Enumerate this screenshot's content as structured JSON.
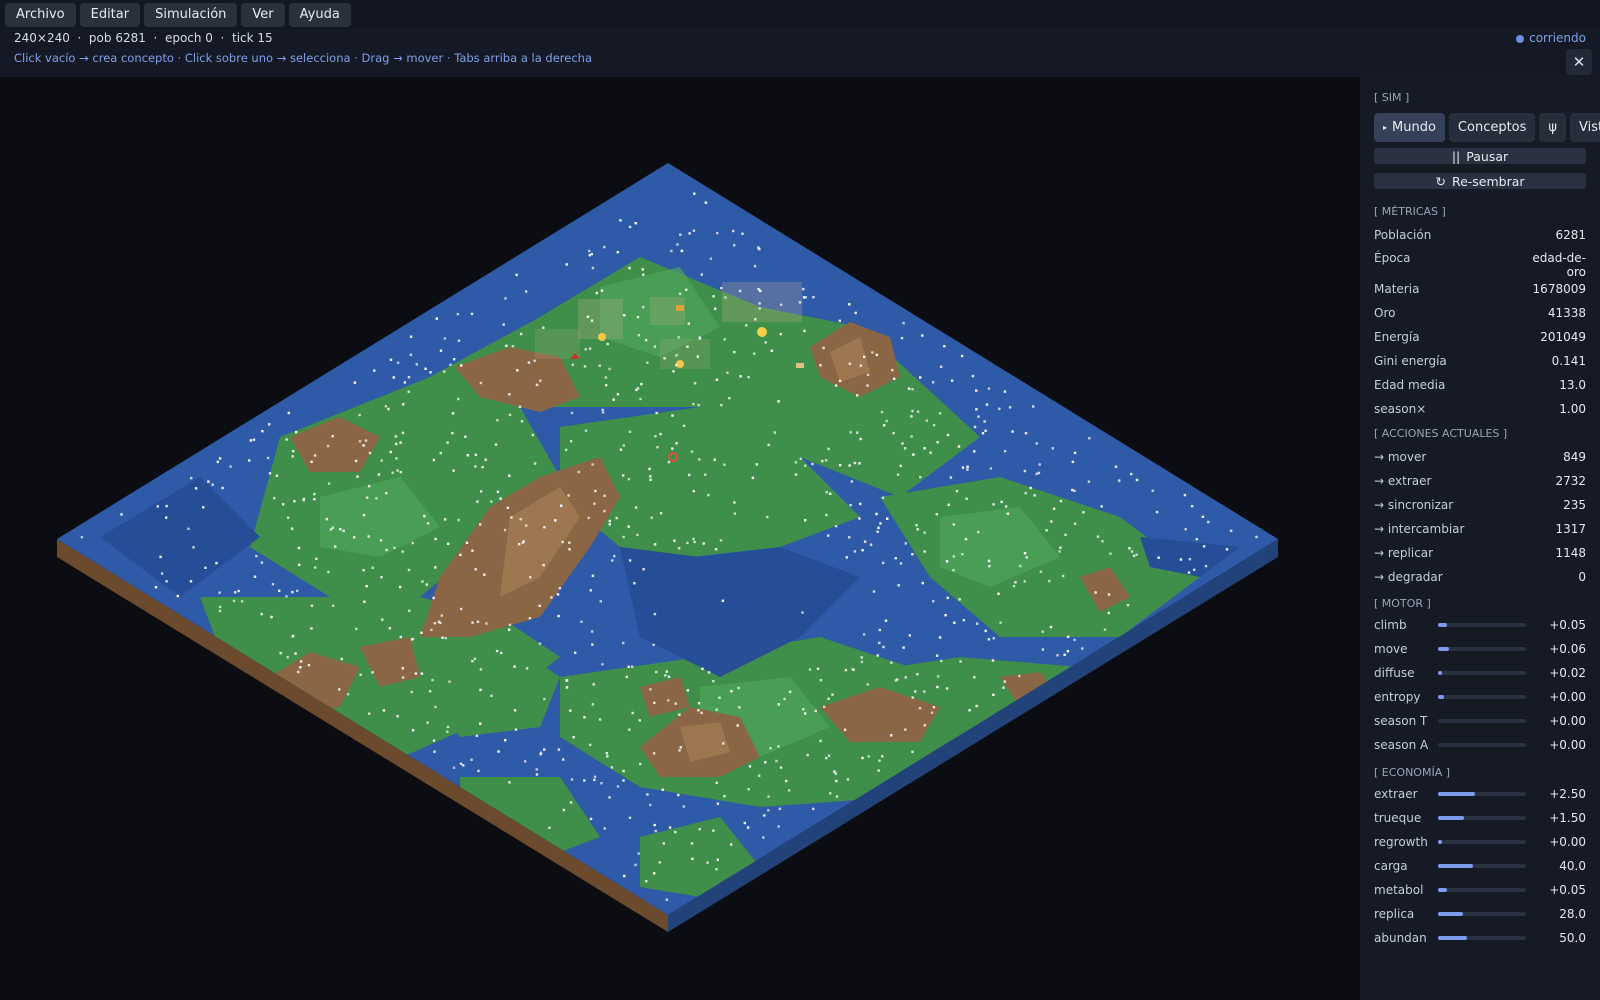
{
  "menu": [
    "Archivo",
    "Editar",
    "Simulación",
    "Ver",
    "Ayuda"
  ],
  "status": {
    "stats": "240×240  ·  pob 6281  ·  epoch 0  ·  tick 15",
    "hint": "Click vacío → crea concepto · Click sobre uno → selecciona · Drag → mover · Tabs arriba a la derecha",
    "running": "corriendo",
    "close": "✕"
  },
  "panel": {
    "sim_title": "[ SIM ]",
    "tabs": [
      "Mundo",
      "Conceptos",
      "ψ",
      "Vista"
    ],
    "active_tab_marker": "▸",
    "pause_label": "Pausar",
    "pause_icon": "||",
    "reseed_label": "Re-sembrar",
    "reseed_icon": "↻",
    "metrics_title": "[ MÉTRICAS ]",
    "metrics": [
      {
        "label": "Población",
        "value": "6281"
      },
      {
        "label": "Época",
        "value": "edad-de-\noro"
      },
      {
        "label": "Materia",
        "value": "1678009"
      },
      {
        "label": "Oro",
        "value": "41338"
      },
      {
        "label": "Energía",
        "value": "201049"
      },
      {
        "label": "Gini energía",
        "value": "0.141"
      },
      {
        "label": "Edad media",
        "value": "13.0"
      },
      {
        "label": "season×",
        "value": "1.00"
      }
    ],
    "actions_title": "[ ACCIONES ACTUALES ]",
    "actions": [
      {
        "label": "→ mover",
        "value": "849"
      },
      {
        "label": "→ extraer",
        "value": "2732"
      },
      {
        "label": "→ sincronizar",
        "value": "235"
      },
      {
        "label": "→ intercambiar",
        "value": "1317"
      },
      {
        "label": "→ replicar",
        "value": "1148"
      },
      {
        "label": "→ degradar",
        "value": "0"
      }
    ],
    "motor_title": "[ MOTOR ]",
    "motor": [
      {
        "label": "climb",
        "value": "+0.05",
        "fill": 0.1
      },
      {
        "label": "move",
        "value": "+0.06",
        "fill": 0.12
      },
      {
        "label": "diffuse",
        "value": "+0.02",
        "fill": 0.04
      },
      {
        "label": "entropy",
        "value": "+0.00",
        "fill": 0.07
      },
      {
        "label": "season T",
        "value": "+0.00",
        "fill": 0
      },
      {
        "label": "season A",
        "value": "+0.00",
        "fill": 0
      }
    ],
    "econ_title": "[ ECONOMÍA ]",
    "economy": [
      {
        "label": "extraer",
        "value": "+2.50",
        "fill": 0.42
      },
      {
        "label": "trueque",
        "value": "+1.50",
        "fill": 0.3
      },
      {
        "label": "regrowth",
        "value": "+0.00",
        "fill": 0.03
      },
      {
        "label": "carga",
        "value": "40.0",
        "fill": 0.4
      },
      {
        "label": "metabol",
        "value": "+0.05",
        "fill": 0.1
      },
      {
        "label": "replica",
        "value": "28.0",
        "fill": 0.28
      },
      {
        "label": "abundan",
        "value": "50.0",
        "fill": 0.33
      }
    ]
  },
  "colors": {
    "water": "#2f5aa8",
    "grass": "#3f8f4a",
    "mountain": "#8a6644",
    "accent": "#7d9bea"
  }
}
